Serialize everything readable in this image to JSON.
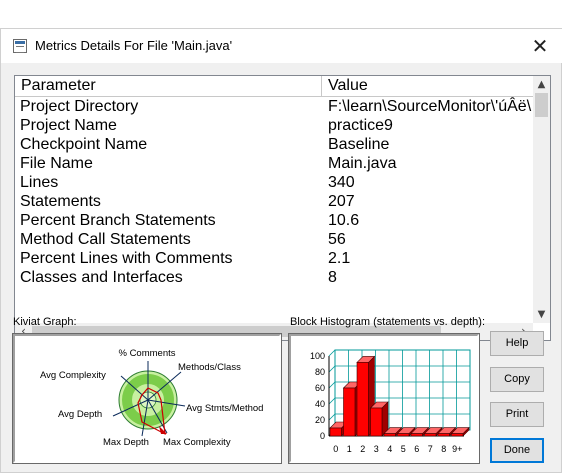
{
  "window": {
    "title": "Metrics Details For File 'Main.java'",
    "close_glyph": "✕"
  },
  "grid": {
    "headers": {
      "parameter": "Parameter",
      "value": "Value"
    },
    "rows": [
      {
        "parameter": "Project Directory",
        "value": "F:\\learn\\SourceMonitor\\'úÂë\\"
      },
      {
        "parameter": "Project Name",
        "value": "practice9"
      },
      {
        "parameter": "Checkpoint Name",
        "value": "Baseline"
      },
      {
        "parameter": "File Name",
        "value": "Main.java"
      },
      {
        "parameter": "Lines",
        "value": "340"
      },
      {
        "parameter": "Statements",
        "value": "207"
      },
      {
        "parameter": "Percent Branch Statements",
        "value": "10.6"
      },
      {
        "parameter": "Method Call Statements",
        "value": "56"
      },
      {
        "parameter": "Percent Lines with Comments",
        "value": "2.1"
      },
      {
        "parameter": "Classes and Interfaces",
        "value": "8"
      }
    ]
  },
  "kiviat": {
    "label": "Kiviat Graph:",
    "axes": {
      "comments": "% Comments",
      "methods_class": "Methods/Class",
      "avg_stmts_method": "Avg Stmts/Method",
      "max_complexity": "Max Complexity",
      "max_depth": "Max Depth",
      "avg_depth": "Avg Depth",
      "avg_complexity": "Avg Complexity"
    },
    "colors": {
      "ring": "#c8f0a0",
      "band": "#7ccd4a",
      "profile": "#cc0000"
    }
  },
  "histogram": {
    "label": "Block Histogram (statements vs. depth):",
    "bar_color": "#ff0000",
    "chart_data": {
      "type": "bar",
      "categories": [
        "0",
        "1",
        "2",
        "3",
        "4",
        "5",
        "6",
        "7",
        "8",
        "9+"
      ],
      "values": [
        10,
        60,
        92,
        35,
        3,
        3,
        3,
        3,
        3,
        3
      ],
      "ylim": [
        0,
        100
      ],
      "yticks": [
        "0",
        "20",
        "40",
        "60",
        "80",
        "100"
      ]
    }
  },
  "buttons": {
    "help": "Help",
    "copy": "Copy",
    "print": "Print",
    "done": "Done"
  }
}
